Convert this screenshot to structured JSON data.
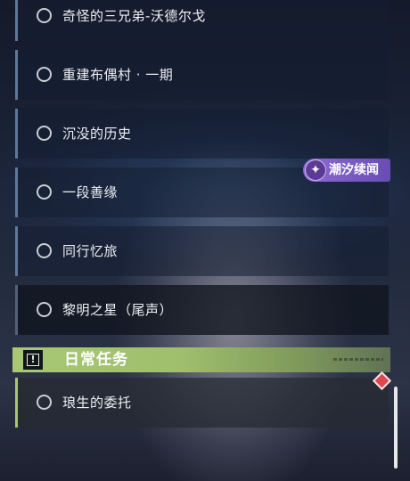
{
  "quests": [
    {
      "label": "奇怪的三兄弟-沃德尔戈"
    },
    {
      "label": "重建布偶村 · 一期"
    },
    {
      "label": "沉没的历史"
    },
    {
      "label": "一段善缘"
    },
    {
      "label": "同行忆旅"
    },
    {
      "label": "黎明之星（尾声）"
    }
  ],
  "tide_badge": {
    "label": "潮汐续闻"
  },
  "daily_section": {
    "title": "日常任务",
    "icon": "exclamation-box-icon",
    "quests": [
      {
        "label": "琅生的委托"
      }
    ]
  },
  "colors": {
    "daily_accent": "#a9c875",
    "badge_purple": "#966edc",
    "marker_red": "#e0464d"
  }
}
